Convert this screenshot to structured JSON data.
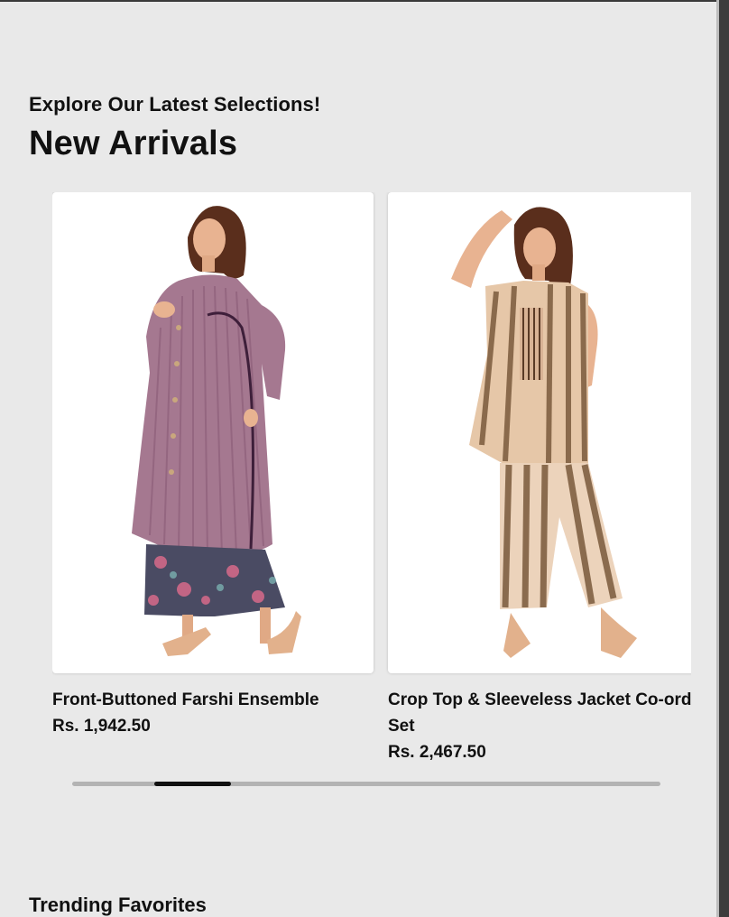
{
  "section": {
    "kicker": "Explore Our Latest Selections!",
    "title": "New Arrivals"
  },
  "products": [
    {
      "title": "Front-Buttoned Farshi Ensemble",
      "price": "Rs. 1,942.50"
    },
    {
      "title": "Crop Top & Sleeveless Jacket Co-ord Set",
      "price": "Rs. 2,467.50"
    }
  ],
  "scroll": {
    "thumb_position_fraction": 0.14,
    "thumb_size_fraction": 0.13
  },
  "next_section": {
    "title": "Trending Favorites"
  },
  "colors": {
    "background": "#e9e9e9",
    "text": "#111111",
    "scroll_track": "#b3b3b3",
    "scroll_thumb": "#111111"
  }
}
